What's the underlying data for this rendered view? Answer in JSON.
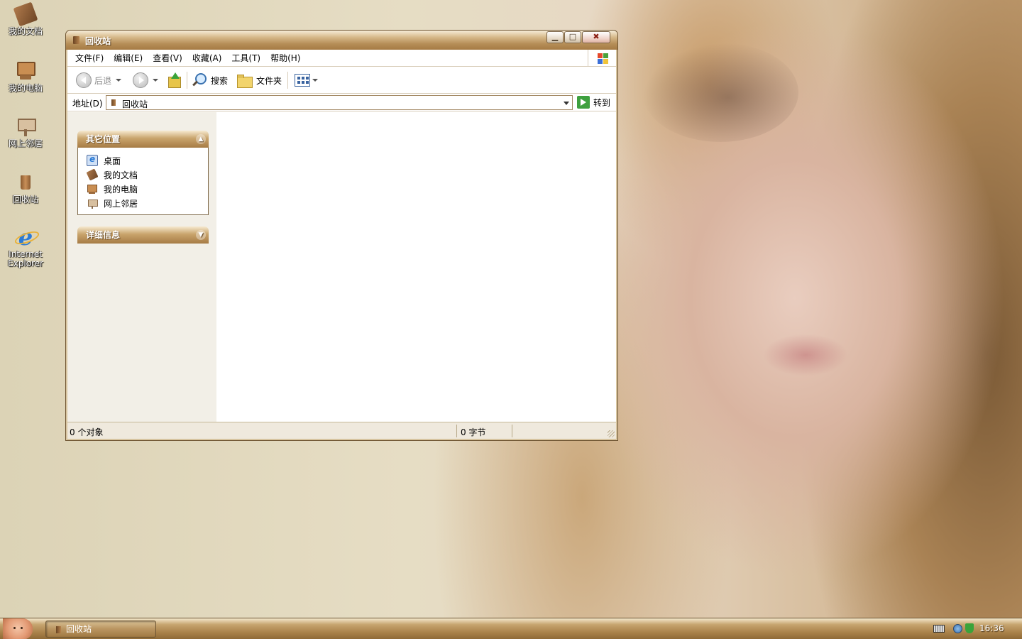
{
  "desktop": {
    "icons": [
      {
        "label": "我的文档",
        "icon": "my-documents-icon"
      },
      {
        "label": "我的电脑",
        "icon": "my-computer-icon"
      },
      {
        "label": "网上邻居",
        "icon": "network-places-icon"
      },
      {
        "label": "回收站",
        "icon": "recycle-bin-icon"
      },
      {
        "label": "Internet Explorer",
        "icon": "internet-explorer-icon"
      }
    ]
  },
  "window": {
    "title": "回收站",
    "controls": {
      "minimize": "▁",
      "maximize": "□",
      "close": "✖"
    },
    "menu": [
      "文件(F)",
      "编辑(E)",
      "查看(V)",
      "收藏(A)",
      "工具(T)",
      "帮助(H)"
    ],
    "toolbar": {
      "back": "后退",
      "search": "搜索",
      "folders": "文件夹"
    },
    "address": {
      "label": "地址(D)",
      "value": "回收站",
      "go": "转到"
    },
    "taskpane": {
      "other_places": {
        "title": "其它位置",
        "items": [
          {
            "label": "桌面",
            "icon": "desktop-icon"
          },
          {
            "label": "我的文档",
            "icon": "my-documents-icon"
          },
          {
            "label": "我的电脑",
            "icon": "my-computer-icon"
          },
          {
            "label": "网上邻居",
            "icon": "network-places-icon"
          }
        ]
      },
      "details": {
        "title": "详细信息"
      }
    },
    "status": {
      "objects": "0 个对象",
      "size": "0 字节"
    }
  },
  "taskbar": {
    "tasks": [
      {
        "label": "回收站"
      }
    ],
    "clock": "16:36"
  },
  "colors": {
    "accent": "#a67b44",
    "title_text": "#ffffff"
  }
}
